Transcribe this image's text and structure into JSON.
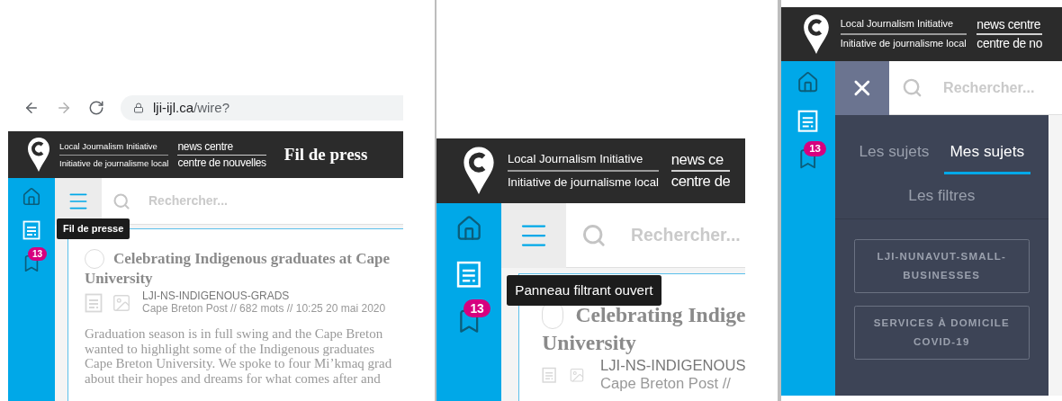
{
  "browser": {
    "url_host": "lji-ijl.ca",
    "url_path": "/wire?"
  },
  "panels": [
    {
      "header": {
        "org_en": "Local Journalism Initiative",
        "org_fr": "Initiative de journalisme local",
        "centre_en": "news centre",
        "centre_fr": "centre de nouvelles",
        "title": "Fil de press"
      },
      "nav": [
        {
          "kind": "home",
          "selected": false
        },
        {
          "kind": "wire",
          "selected": true,
          "tooltip": "Fil de presse"
        },
        {
          "kind": "saved",
          "selected": false,
          "badge": "13"
        }
      ],
      "toggle": {
        "kind": "menu"
      },
      "search": {
        "placeholder": "Rechercher..."
      },
      "story": {
        "checked": false,
        "title_lines": [
          "Celebrating Indigenous graduates at Cape",
          "University"
        ],
        "slug": "LJI-NS-INDIGENOUS-GRADS",
        "meta": "Cape Breton Post // 682 mots // 10:25 20 mai 2020",
        "body_lines": [
          "Graduation season is in full swing and the Cape Breton",
          "wanted to highlight some of the Indigenous graduates",
          "Cape Breton University. We spoke to four Mi’kmaq grad",
          "about their hopes and dreams for what comes after and"
        ]
      }
    },
    {
      "header": {
        "org_en": "Local Journalism Initiative",
        "org_fr": "Initiative de journalisme local",
        "centre_en": "news ce",
        "centre_fr": "centre de"
      },
      "nav": [
        {
          "kind": "home",
          "selected": false
        },
        {
          "kind": "wire",
          "selected": true
        },
        {
          "kind": "saved",
          "selected": false,
          "badge": "13"
        }
      ],
      "toggle": {
        "kind": "menu",
        "tooltip": "Panneau filtrant ouvert"
      },
      "search": {
        "placeholder": "Rechercher..."
      },
      "story": {
        "checked": false,
        "title_lines": [
          "Celebrating Indige",
          "University"
        ],
        "slug": "LJI-NS-INDIGENOUS",
        "meta": "Cape Breton Post //"
      }
    },
    {
      "header": {
        "org_en": "Local Journalism Initiative",
        "org_fr": "Initiative de journalisme local",
        "centre_en": "news centre",
        "centre_fr": "centre de no"
      },
      "nav": [
        {
          "kind": "home",
          "selected": false
        },
        {
          "kind": "wire",
          "selected": true
        },
        {
          "kind": "saved",
          "selected": false,
          "badge": "13"
        }
      ],
      "toggle": {
        "kind": "close"
      },
      "search": {
        "placeholder": "Rechercher..."
      },
      "drawer": {
        "tabs": [
          {
            "label": "Les sujets",
            "selected": false
          },
          {
            "label": "Mes sujets",
            "selected": true
          }
        ],
        "filters_link": "Les filtres",
        "topics": [
          "LJI-NUNAVUT-SMALL-BUSINESSES",
          "SERVICES À DOMICILE COVID-19"
        ]
      }
    }
  ]
}
